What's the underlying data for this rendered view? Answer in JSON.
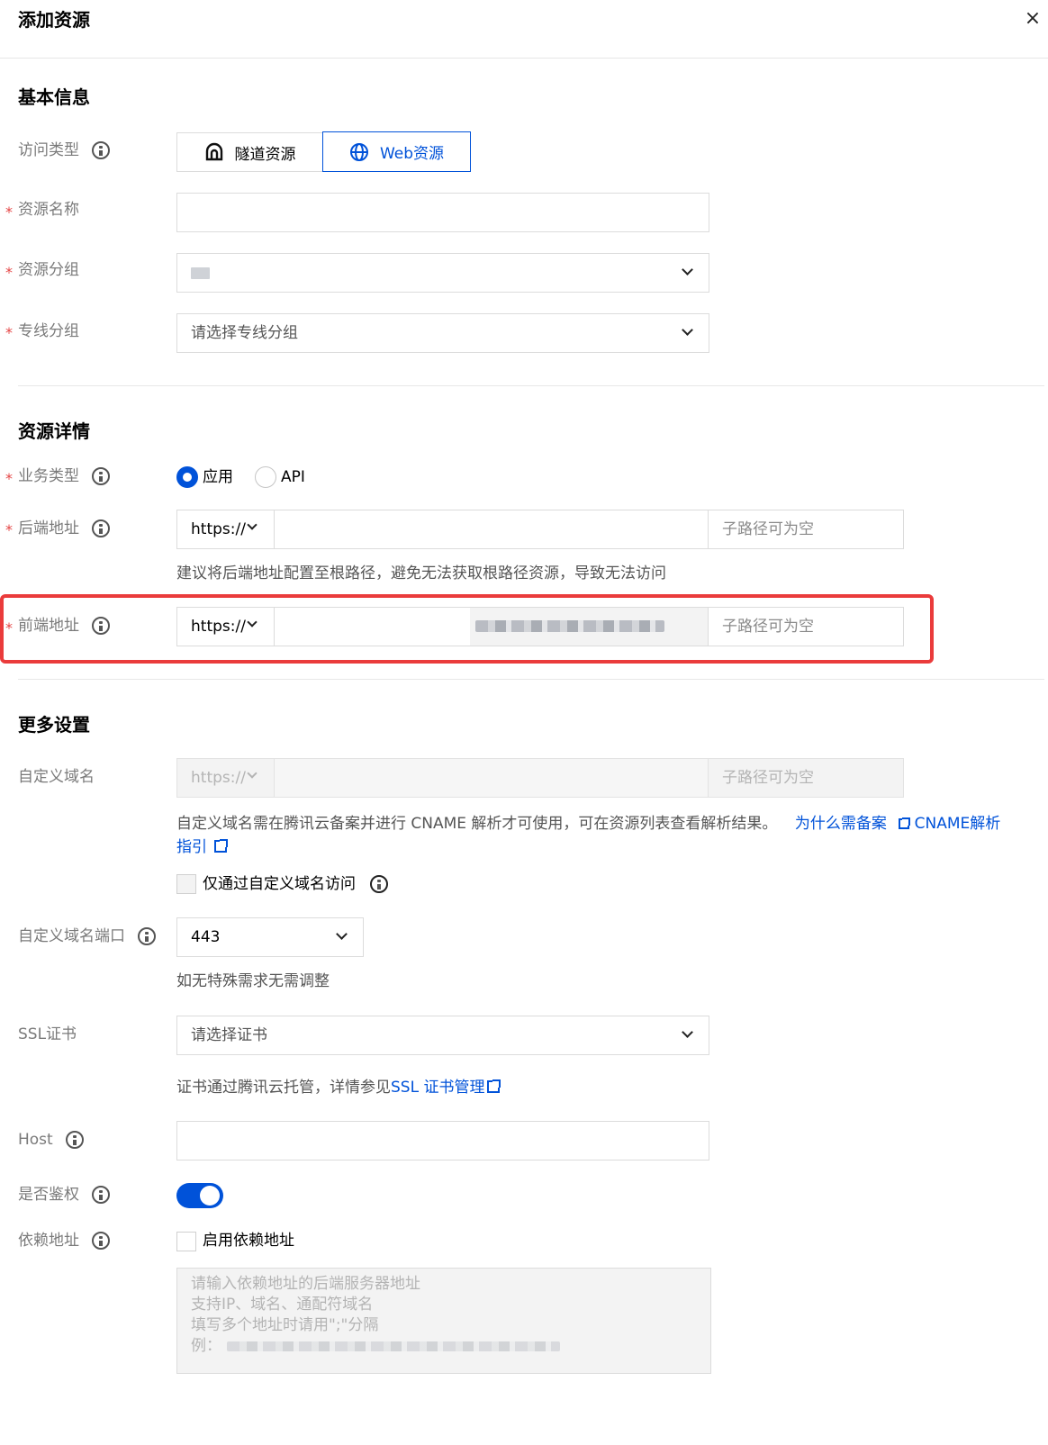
{
  "dialog": {
    "title": "添加资源",
    "close_label": "×"
  },
  "basic": {
    "section_title": "基本信息",
    "access_type": {
      "label": "访问类型",
      "options": [
        "隧道资源",
        "Web资源"
      ],
      "selected": "Web资源"
    },
    "resource_name": {
      "label": "资源名称",
      "value": ""
    },
    "resource_group": {
      "label": "资源分组"
    },
    "line_group": {
      "label": "专线分组",
      "placeholder": "请选择专线分组"
    }
  },
  "details": {
    "section_title": "资源详情",
    "business_type": {
      "label": "业务类型",
      "options": [
        "应用",
        "API"
      ],
      "selected": "应用"
    },
    "backend": {
      "label": "后端地址",
      "protocol": "https://",
      "subpath_placeholder": "子路径可为空",
      "hint": "建议将后端地址配置至根路径，避免无法获取根路径资源，导致无法访问"
    },
    "frontend": {
      "label": "前端地址",
      "protocol": "https://",
      "subpath_placeholder": "子路径可为空"
    }
  },
  "more": {
    "section_title": "更多设置",
    "custom_domain": {
      "label": "自定义域名",
      "protocol": "https://",
      "subpath_placeholder": "子路径可为空",
      "hint_text": "自定义域名需在腾讯云备案并进行 CNAME 解析才可使用，可在资源列表查看解析结果。",
      "link_why": "为什么需备案",
      "link_cname_a": "CNAME解析",
      "link_cname_b": "指引",
      "only_custom_label": "仅通过自定义域名访问"
    },
    "custom_port": {
      "label": "自定义域名端口",
      "value": "443",
      "hint": "如无特殊需求无需调整"
    },
    "ssl": {
      "label": "SSL证书",
      "placeholder": "请选择证书",
      "hint_prefix": "证书通过腾讯云托管，详情参见",
      "hint_link": "SSL 证书管理"
    },
    "host": {
      "label": "Host",
      "value": ""
    },
    "auth": {
      "label": "是否鉴权",
      "enabled": true
    },
    "dependency": {
      "label": "依赖地址",
      "checkbox_label": "启用依赖地址",
      "placeholder_lines": [
        "请输入依赖地址的后端服务器地址",
        "支持IP、域名、通配符域名",
        "填写多个地址时请用\";\"分隔",
        "例："
      ]
    }
  },
  "colors": {
    "primary": "#0052d9",
    "required": "#e54545",
    "highlight": "#ea3b3b"
  }
}
